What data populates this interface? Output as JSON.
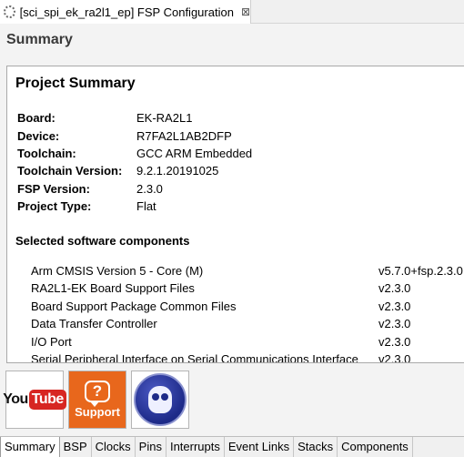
{
  "editor": {
    "tab_title": "[sci_spi_ek_ra2l1_ep] FSP Configuration",
    "tab_icon": "gear-icon",
    "close_glyph": "⊠"
  },
  "header": {
    "title": "Summary"
  },
  "summary": {
    "title": "Project Summary",
    "rows": [
      {
        "key": "Board:",
        "value": "EK-RA2L1"
      },
      {
        "key": "Device:",
        "value": "R7FA2L1AB2DFP"
      },
      {
        "key": "Toolchain:",
        "value": "GCC ARM Embedded"
      },
      {
        "key": "Toolchain Version:",
        "value": "9.2.1.20191025"
      },
      {
        "key": "FSP Version:",
        "value": "2.3.0"
      },
      {
        "key": "Project Type:",
        "value": "Flat"
      }
    ],
    "components_title": "Selected software components",
    "components": [
      {
        "name": "Arm CMSIS Version 5 - Core (M)",
        "version": "v5.7.0+fsp.2.3.0"
      },
      {
        "name": "RA2L1-EK Board Support Files",
        "version": "v2.3.0"
      },
      {
        "name": "Board Support Package Common Files",
        "version": "v2.3.0"
      },
      {
        "name": "Data Transfer Controller",
        "version": "v2.3.0"
      },
      {
        "name": "I/O Port",
        "version": "v2.3.0"
      },
      {
        "name": "Serial Peripheral Interface on Serial Communications Interface",
        "version": "v2.3.0"
      }
    ]
  },
  "icons": {
    "youtube_you": "You",
    "youtube_tube": "Tube",
    "support_glyph": "?",
    "support_label": "Support",
    "colors": {
      "youtube_red": "#d72622",
      "support_orange": "#e8671c",
      "owl_blue": "#1d2a88"
    }
  },
  "pagetabs": [
    "Summary",
    "BSP",
    "Clocks",
    "Pins",
    "Interrupts",
    "Event Links",
    "Stacks",
    "Components"
  ],
  "active_tab": "Summary"
}
